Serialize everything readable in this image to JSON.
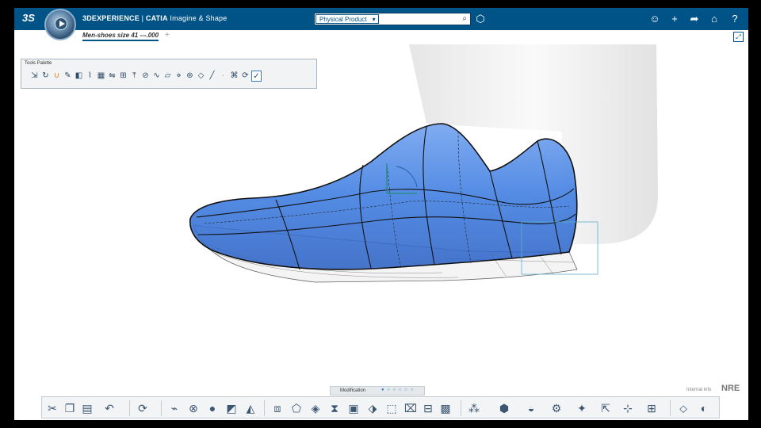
{
  "topbar": {
    "brand": "3DEXPERIENCE",
    "product": "CATIA",
    "app_name": "Imagine & Shape",
    "logo_icon": "ds-logo-icon",
    "compass_icon": "compass-icon"
  },
  "search": {
    "scope_value": "Physical Product",
    "placeholder": "",
    "icon": "search-icon"
  },
  "topbar_right_icons": [
    "tag-icon",
    "user-icon",
    "add-icon",
    "share-icon",
    "home-icon",
    "help-icon"
  ],
  "tabs": {
    "active_document": "Men-shoes size 41 ---.000",
    "add_label": "+"
  },
  "tools_palette": {
    "title": "Tools Palette",
    "icons": [
      "move-icon",
      "rotate-icon",
      "magnet-icon",
      "edit-icon",
      "cube-icon",
      "edge-icon",
      "mesh-icon",
      "symmetry-icon",
      "subdivide-icon",
      "extrude-icon",
      "split-icon",
      "curve-icon",
      "face-icon",
      "vertex-icon",
      "weight-icon",
      "diamond-icon",
      "line-icon",
      "dot-icon",
      "attract-icon",
      "refresh-icon",
      "checkbox-icon"
    ]
  },
  "modification_bar": {
    "label": "Modification",
    "dots": "● ○ ○ ○ ○ ○"
  },
  "watermark": {
    "internal": "Internal info",
    "nre": "NRE"
  },
  "bottom_toolbar": {
    "icons": [
      "cut-icon",
      "copy-icon",
      "paste-icon",
      "undo-icon",
      "refresh-icon",
      "sweep-icon",
      "blend-icon",
      "sphere-icon",
      "surface-icon",
      "fill-icon",
      "box-icon",
      "shape-icon",
      "cube-icon",
      "twist-icon",
      "face-icon",
      "split-icon",
      "edit-icon",
      "trim-icon",
      "wrap-icon",
      "grid-icon",
      "view-icon",
      "render-icon",
      "material-icon",
      "pin-icon",
      "select-icon",
      "xyz-icon",
      "snap-icon",
      "camera-icon",
      "eye-icon"
    ]
  },
  "colors": {
    "topbar": "#005386",
    "shoe_blue": "#3b7be0",
    "palette_bg": "#f1f3f5"
  }
}
